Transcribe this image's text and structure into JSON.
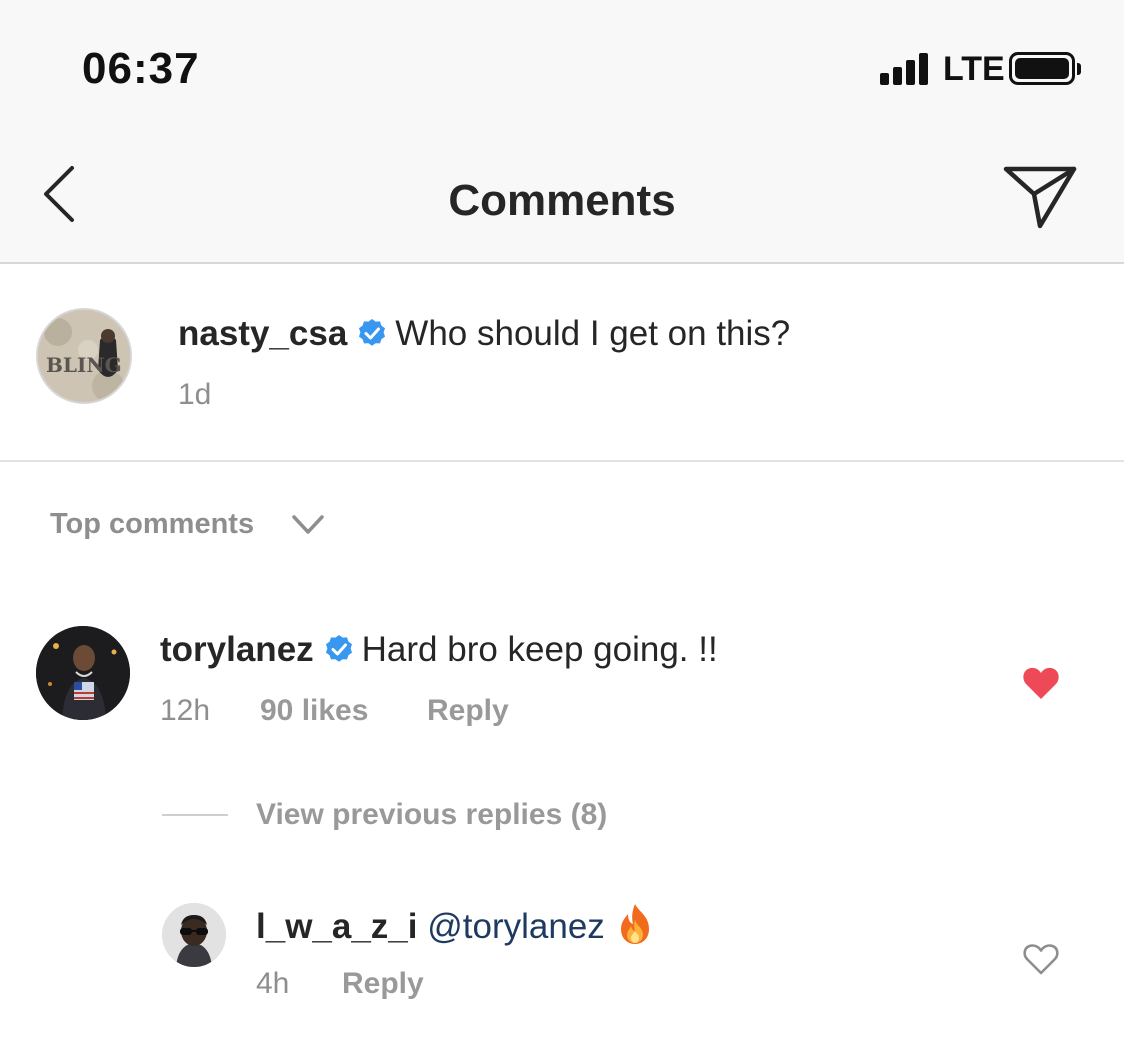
{
  "status_bar": {
    "time": "06:37",
    "network": "LTE",
    "signal_bars": 4,
    "battery_icon": "battery-full-icon"
  },
  "nav": {
    "title": "Comments",
    "back_icon": "chevron-left-icon",
    "send_icon": "send-icon"
  },
  "caption": {
    "username": "nasty_csa",
    "verified": true,
    "text": "Who should I get on this?",
    "time": "1d",
    "avatar_text": "BLING"
  },
  "sort": {
    "label": "Top comments",
    "icon": "chevron-down-icon"
  },
  "comments": [
    {
      "username": "torylanez",
      "verified": true,
      "text": "Hard bro keep going. !!",
      "time": "12h",
      "likes": "90 likes",
      "reply_label": "Reply",
      "liked": true,
      "replies_toggle": "View previous replies (8)",
      "replies": [
        {
          "username": "l_w_a_z_i",
          "mention": "@torylanez",
          "emoji": "fire-emoji",
          "time": "4h",
          "reply_label": "Reply",
          "liked": false
        }
      ]
    }
  ],
  "colors": {
    "verified_blue": "#3897f0",
    "like_red": "#ed4956",
    "mention_blue": "#1e3a5f",
    "muted_gray": "#8e8e8e"
  }
}
